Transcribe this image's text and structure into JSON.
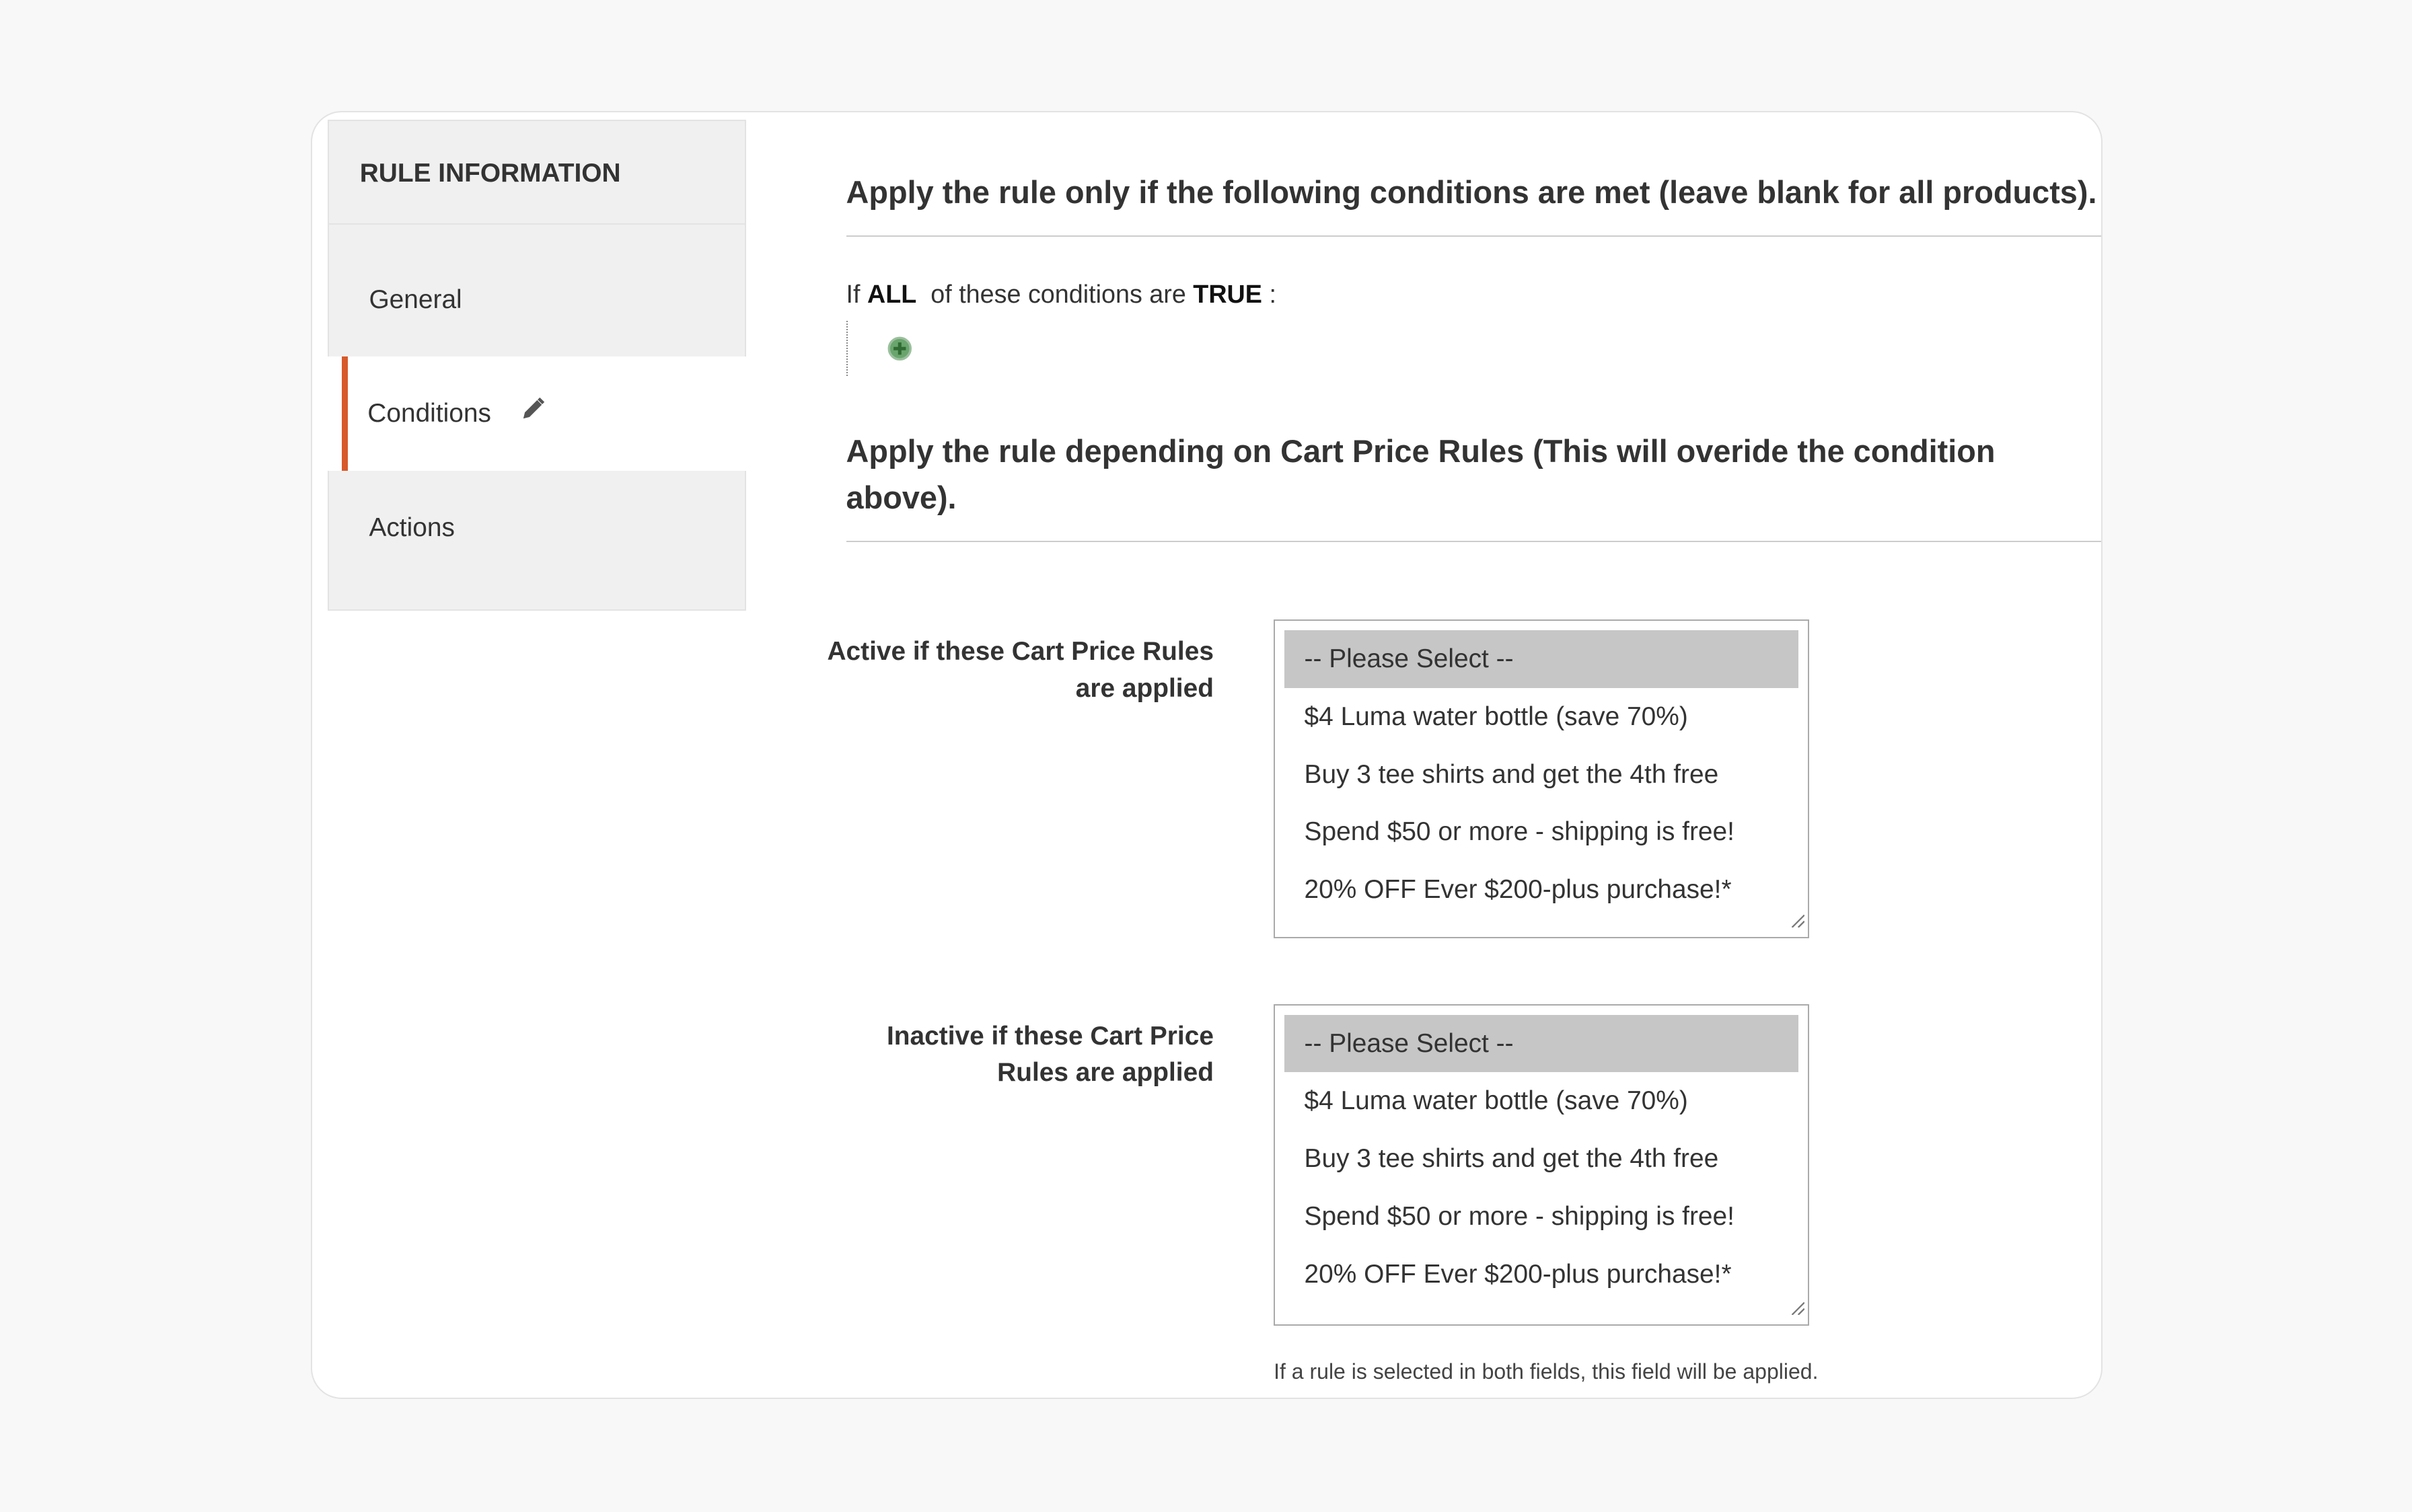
{
  "sidebar": {
    "title": "RULE INFORMATION",
    "items": [
      {
        "label": "General",
        "icon": null
      },
      {
        "label": "Conditions",
        "icon": "pencil-icon",
        "active": true
      },
      {
        "label": "Actions",
        "icon": null
      }
    ],
    "accent_color": "#d85a2a"
  },
  "main": {
    "conditions_heading": "Apply the rule only if the following conditions are met (leave blank for all products).",
    "condition_line": {
      "prefix": "If",
      "aggregator": "ALL",
      "middle": "of these conditions are",
      "value": "TRUE",
      "suffix": ":"
    },
    "add_condition_icon": "plus-circle-icon",
    "cart_rules_heading": "Apply the rule depending on Cart Price Rules (This will overide the condition above).",
    "active_field": {
      "label": "Active if these Cart Price Rules are applied",
      "options": [
        "-- Please Select --",
        "$4 Luma water bottle (save 70%)",
        "Buy 3 tee shirts and get the 4th free",
        "Spend $50 or more - shipping is free!",
        "20% OFF Ever $200-plus purchase!*"
      ],
      "selected": "-- Please Select --"
    },
    "inactive_field": {
      "label": "Inactive if these Cart Price Rules are applied",
      "options": [
        "-- Please Select --",
        "$4 Luma water bottle (save 70%)",
        "Buy 3 tee shirts and get the 4th free",
        "Spend $50 or more - shipping is free!",
        "20% OFF Ever $200-plus purchase!*"
      ],
      "selected": "-- Please Select --",
      "note": "If a rule is selected in both fields, this field will be applied."
    }
  }
}
